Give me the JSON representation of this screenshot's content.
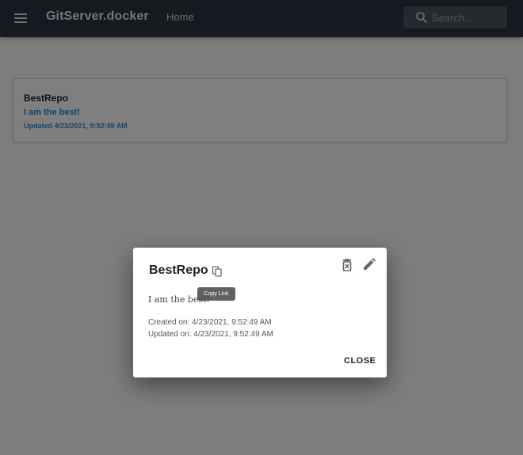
{
  "appbar": {
    "title": "GitServer.docker",
    "nav_home": "Home",
    "search_placeholder": "Search..."
  },
  "repo_card": {
    "name": "BestRepo",
    "description": "I am the best!",
    "updated": "Updated 4/23/2021, 9:52:49 AM"
  },
  "dialog": {
    "title": "BestRepo",
    "copy_tooltip": "Copy Link",
    "description": "I am the best!",
    "created": "Created on: 4/23/2021, 9:52:49 AM",
    "updated": "Updated on: 4/23/2021, 9:52:49 AM",
    "close_label": "CLOSE"
  },
  "icons": {
    "menu": "menu-icon",
    "search": "search-icon",
    "copy": "copy-icon",
    "delete": "delete-icon",
    "edit": "pencil-icon"
  },
  "colors": {
    "appbar": "#2d3441",
    "link_blue": "#1e88e5"
  }
}
